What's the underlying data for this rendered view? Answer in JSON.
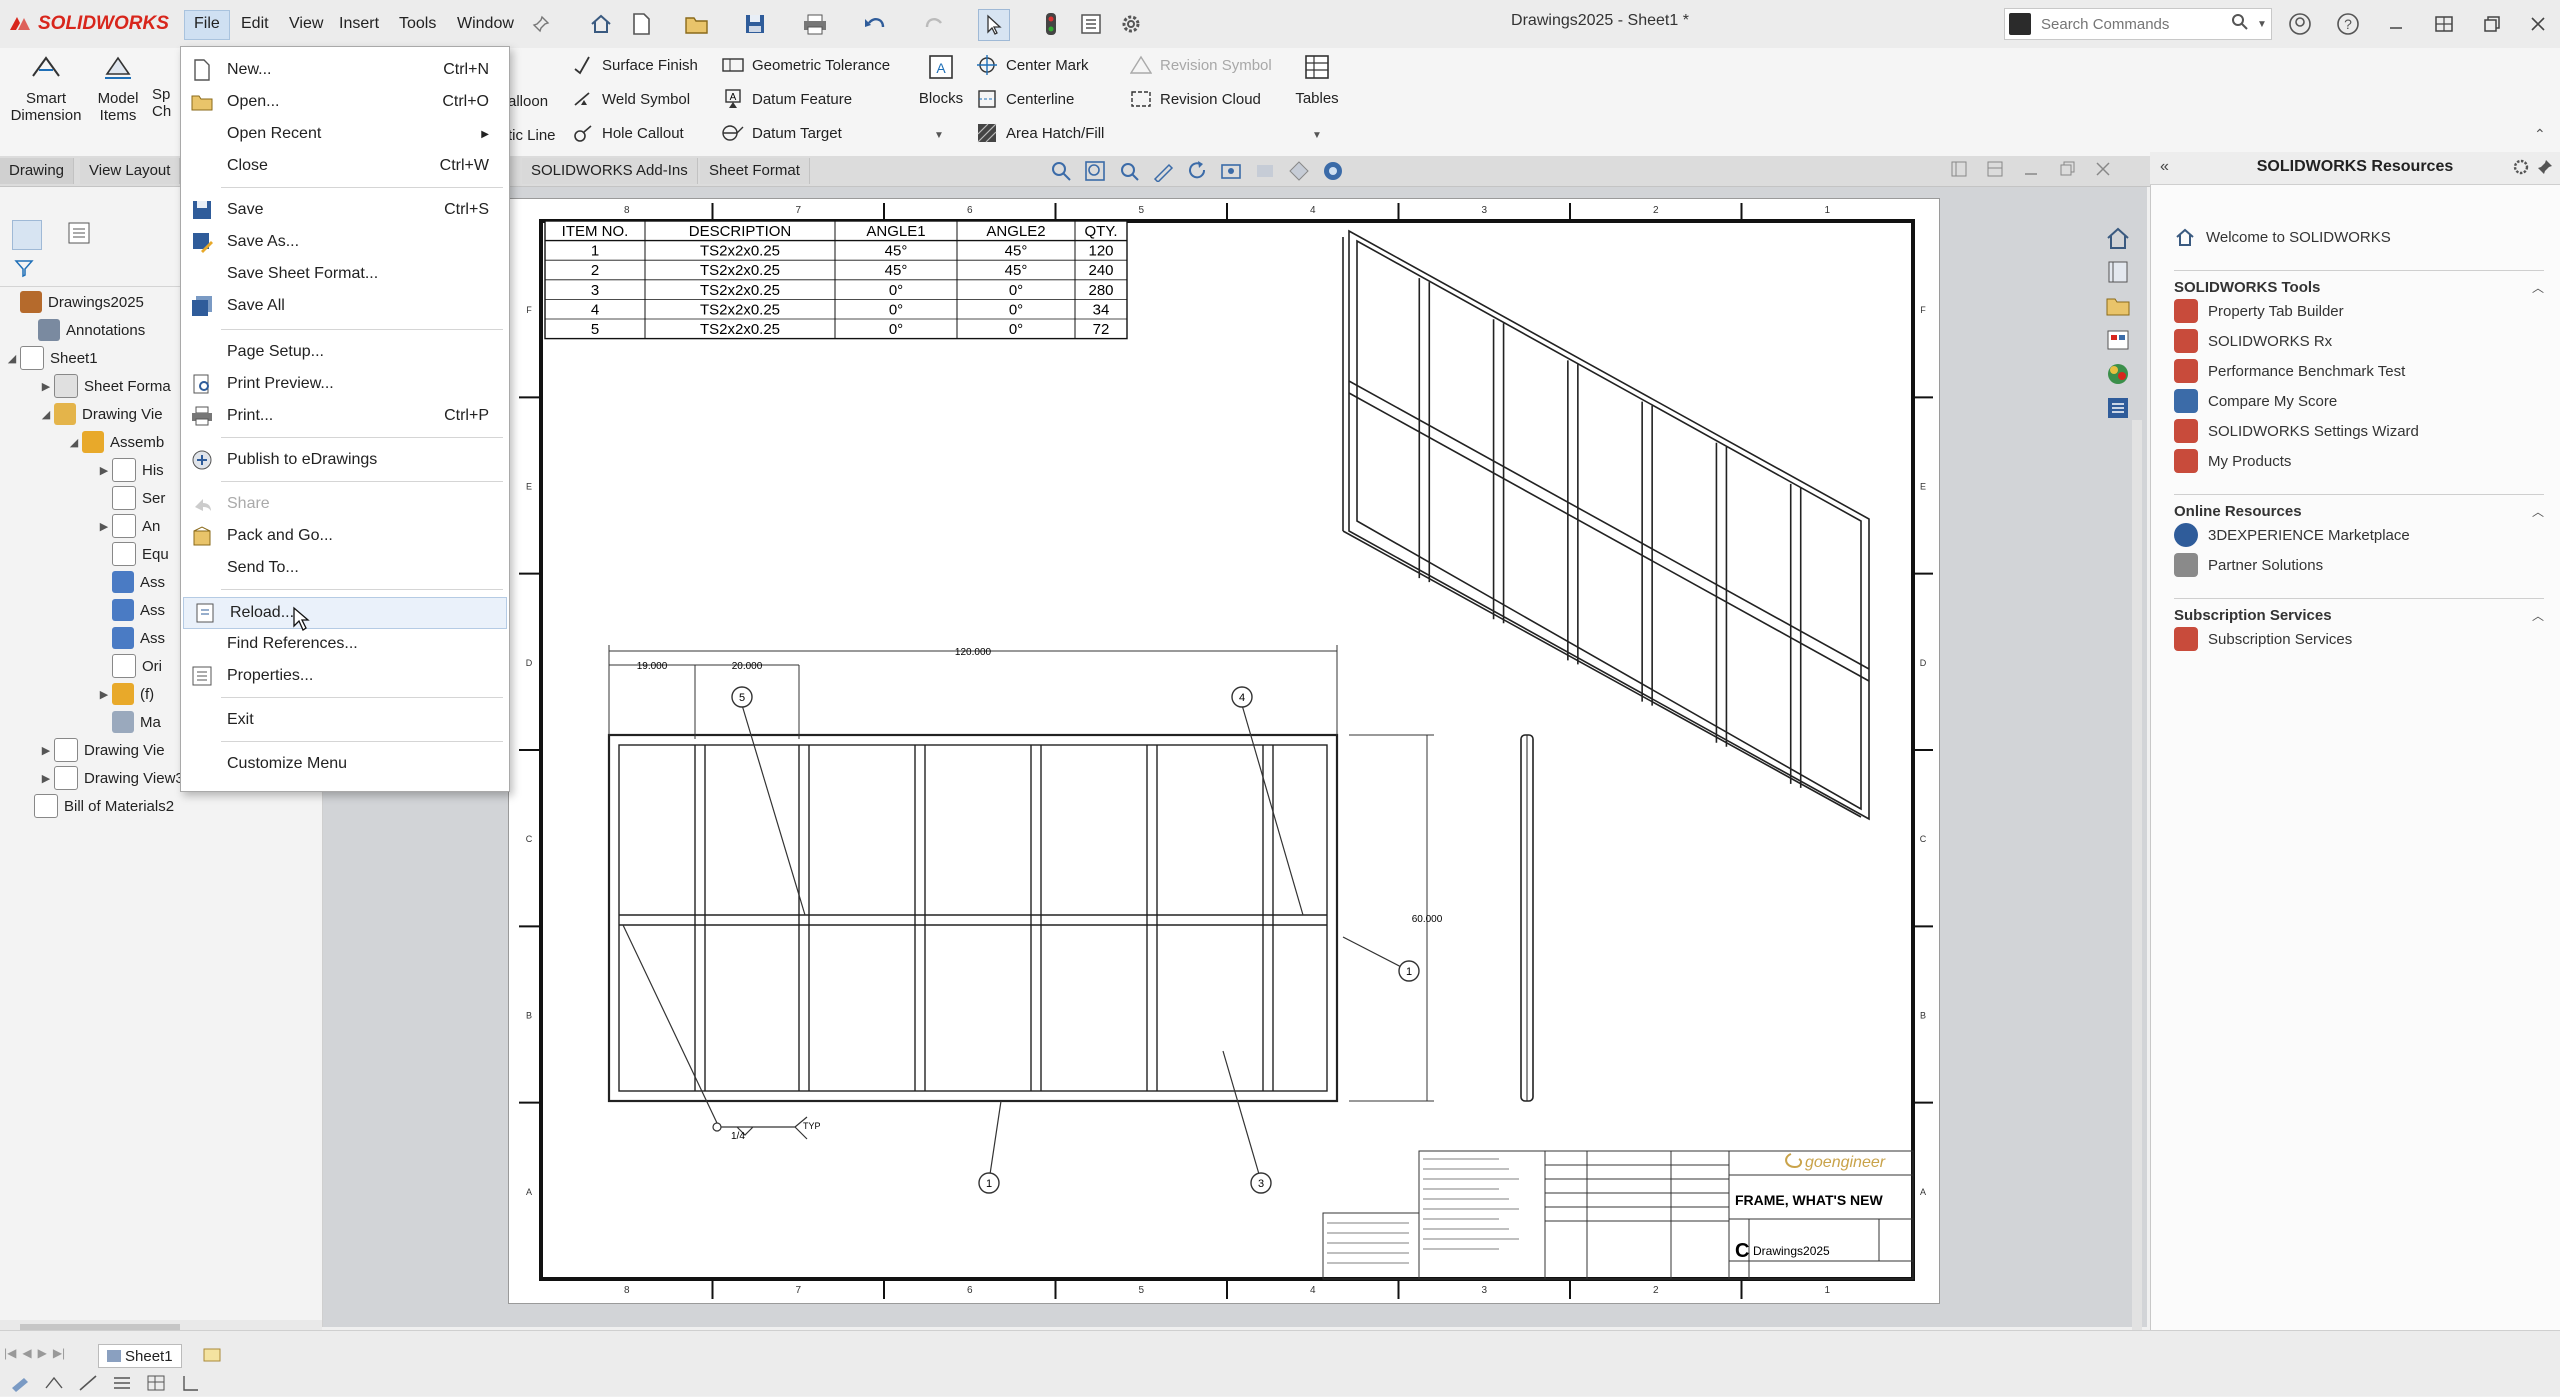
{
  "app": {
    "name": "SOLIDWORKS",
    "doc_title": "Drawings2025 - Sheet1 *"
  },
  "menubar": [
    "File",
    "Edit",
    "View",
    "Insert",
    "Tools",
    "Window"
  ],
  "search": {
    "placeholder": "Search Commands"
  },
  "ribbon": {
    "smart_dimension": "Smart Dimension",
    "model_items": "Model Items",
    "spell_checker": "Sp Ch",
    "balloon": "alloon",
    "magnetic_line": "tic Line",
    "surface_finish": "Surface Finish",
    "weld_symbol": "Weld Symbol",
    "hole_callout": "Hole Callout",
    "geometric_tolerance": "Geometric Tolerance",
    "datum_feature": "Datum Feature",
    "datum_target": "Datum Target",
    "blocks": "Blocks",
    "center_mark": "Center Mark",
    "centerline": "Centerline",
    "area_hatch": "Area Hatch/Fill",
    "revision_symbol": "Revision Symbol",
    "revision_cloud": "Revision Cloud",
    "tables": "Tables"
  },
  "tabs": [
    "Drawing",
    "View Layout",
    "SOLIDWORKS Add-Ins",
    "Sheet Format"
  ],
  "file_menu": {
    "new": "New...",
    "new_sc": "Ctrl+N",
    "open": "Open...",
    "open_sc": "Ctrl+O",
    "open_recent": "Open Recent",
    "close": "Close",
    "close_sc": "Ctrl+W",
    "save": "Save",
    "save_sc": "Ctrl+S",
    "save_as": "Save As...",
    "save_sheet_format": "Save Sheet Format...",
    "save_all": "Save All",
    "page_setup": "Page Setup...",
    "print_preview": "Print Preview...",
    "print": "Print...",
    "print_sc": "Ctrl+P",
    "publish": "Publish to eDrawings",
    "share": "Share",
    "pack_and_go": "Pack and Go...",
    "send_to": "Send To...",
    "reload": "Reload...",
    "find_references": "Find References...",
    "properties": "Properties...",
    "exit": "Exit",
    "customize_menu": "Customize Menu"
  },
  "tree": {
    "root": "Drawings2025",
    "annotations": "Annotations",
    "sheet1": "Sheet1",
    "sheet_format": "Sheet Forma",
    "drawing_view1": "Drawing Vie",
    "assembly": "Assemb",
    "history": "His",
    "sensors": "Ser",
    "annotations2": "An",
    "equations": "Equ",
    "ass1": "Ass",
    "ass2": "Ass",
    "ass3": "Ass",
    "origin": "Ori",
    "f": "(f)",
    "mates": "Ma",
    "drawing_view2": "Drawing Vie",
    "drawing_view3": "Drawing View3",
    "bom": "Bill of Materials2"
  },
  "bom_table": {
    "headers": [
      "ITEM NO.",
      "DESCRIPTION",
      "ANGLE1",
      "ANGLE2",
      "QTY."
    ],
    "rows": [
      [
        "1",
        "TS2x2x0.25",
        "45°",
        "45°",
        "120"
      ],
      [
        "2",
        "TS2x2x0.25",
        "45°",
        "45°",
        "240"
      ],
      [
        "3",
        "TS2x2x0.25",
        "0°",
        "0°",
        "280"
      ],
      [
        "4",
        "TS2x2x0.25",
        "0°",
        "0°",
        "34"
      ],
      [
        "5",
        "TS2x2x0.25",
        "0°",
        "0°",
        "72"
      ]
    ]
  },
  "drawing": {
    "dim_overall": "120.000",
    "dim_left": "19.000",
    "dim_mid": "20.000",
    "dim_height": "60.000",
    "weld": "1/4",
    "weld_typ": "TYP",
    "balloons": [
      "5",
      "4",
      "1",
      "1",
      "3"
    ],
    "border_cols": [
      "8",
      "7",
      "6",
      "5",
      "4",
      "3",
      "2",
      "1"
    ],
    "border_rows": [
      "F",
      "E",
      "D",
      "C",
      "B",
      "A"
    ],
    "title": "FRAME, WHAT'S NEW",
    "size": "C",
    "dwg_no": "Drawings2025",
    "logo": "goengineer"
  },
  "task_pane": {
    "title": "SOLIDWORKS Resources",
    "welcome": "Welcome to SOLIDWORKS",
    "tools_header": "SOLIDWORKS Tools",
    "tools": [
      "Property Tab Builder",
      "SOLIDWORKS Rx",
      "Performance Benchmark Test",
      "Compare My Score",
      "SOLIDWORKS Settings Wizard",
      "My Products"
    ],
    "online_header": "Online Resources",
    "online": [
      "3DEXPERIENCE Marketplace",
      "Partner Solutions"
    ],
    "subscription_header": "Subscription Services",
    "subscription": [
      "Subscription Services"
    ]
  },
  "sheet_tab": "Sheet1",
  "colors": {
    "brand": "#d8261c",
    "accent": "#1f6fb7",
    "highlight": "#eaf1fa"
  }
}
